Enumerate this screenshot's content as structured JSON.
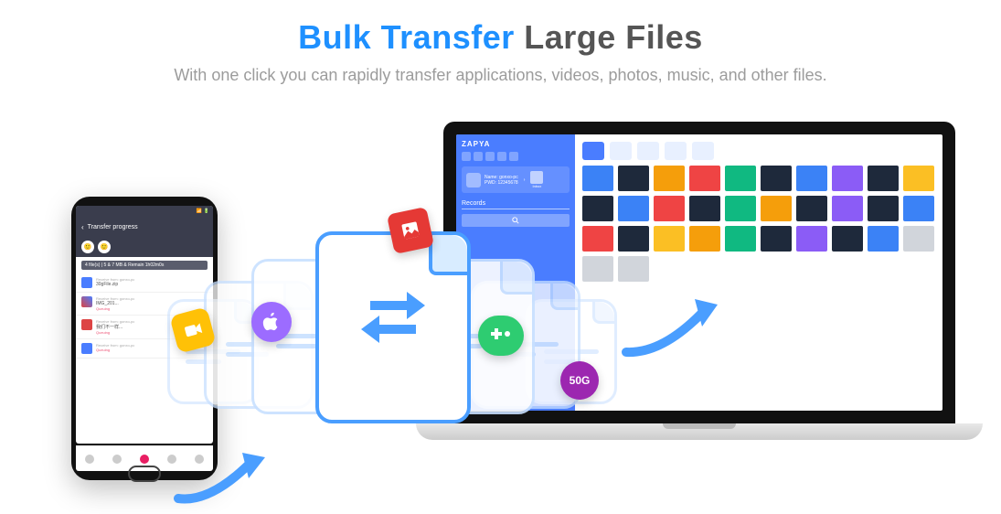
{
  "hero": {
    "title_accent": "Bulk Transfer",
    "title_rest": " Large Files",
    "subtitle": "With one click you can rapidly transfer applications, videos, photos, music, and other files."
  },
  "phone": {
    "header_title": "Transfer progress",
    "progress_text": "4 file(s) | 5 & 7 MB & Remain 1h02m0s",
    "items": [
      {
        "from": "Receive from: gonxo-pc",
        "name": "30gFile.zip",
        "meta": "",
        "queue": ""
      },
      {
        "from": "Receive from: gonxo-pc",
        "name": "IMG_201...",
        "meta": "",
        "queue": "Queuing"
      },
      {
        "from": "Receive from: gonxo-pc",
        "name": "我们不一样...",
        "meta": "",
        "queue": "Queuing"
      },
      {
        "from": "Receive from: gonxo-pc",
        "name": "",
        "meta": "",
        "queue": "Queuing"
      }
    ]
  },
  "laptop": {
    "brand": "ZAPYA",
    "name_label": "Name:",
    "name_value": "gonxo-pc",
    "pwd_label": "PWD:",
    "pwd_value": "12345678",
    "inbox_label": "Inbox",
    "tab_label": "Records",
    "thumb_colors": [
      "#3b82f6",
      "#1e293b",
      "#f59e0b",
      "#ef4444",
      "#10b981",
      "#1e293b",
      "#3b82f6",
      "#8b5cf6",
      "#1e293b",
      "#fbbf24",
      "#1e293b",
      "#3b82f6",
      "#ef4444",
      "#1e293b",
      "#10b981",
      "#f59e0b",
      "#1e293b",
      "#8b5cf6",
      "#1e293b",
      "#3b82f6",
      "#ef4444",
      "#1e293b",
      "#fbbf24",
      "#f59e0b",
      "#10b981",
      "#1e293b",
      "#8b5cf6",
      "#1e293b",
      "#3b82f6",
      "#d1d5db",
      "#d1d5db",
      "#d1d5db"
    ]
  },
  "badges": {
    "photo": "photo-icon",
    "apple": "apple-icon",
    "game": "game-icon",
    "video": "video-icon",
    "size": "50G"
  }
}
